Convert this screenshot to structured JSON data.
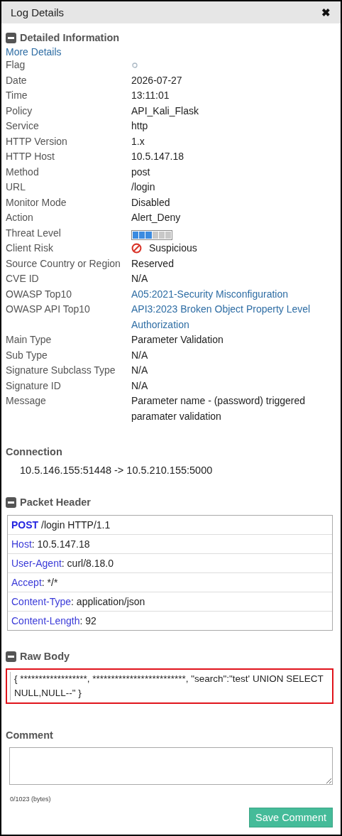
{
  "window": {
    "title": "Log Details",
    "close": "✖"
  },
  "details": {
    "title": "Detailed Information",
    "expanded": true,
    "more_link": "More Details",
    "fields": [
      {
        "label": "Flag",
        "kind": "flag",
        "flagged": false
      },
      {
        "label": "Date",
        "kind": "text",
        "value": "2026-07-27"
      },
      {
        "label": "Time",
        "kind": "text",
        "value": "13:11:01"
      },
      {
        "label": "Policy",
        "kind": "text",
        "value": "API_Kali_Flask"
      },
      {
        "label": "Service",
        "kind": "text",
        "value": "http"
      },
      {
        "label": "HTTP Version",
        "kind": "text",
        "value": "1.x"
      },
      {
        "label": "HTTP Host",
        "kind": "text",
        "value": "10.5.147.18"
      },
      {
        "label": "Method",
        "kind": "text",
        "value": "post"
      },
      {
        "label": "URL",
        "kind": "text",
        "value": "/login"
      },
      {
        "label": "Monitor Mode",
        "kind": "text",
        "value": "Disabled"
      },
      {
        "label": "Action",
        "kind": "text",
        "value": "Alert_Deny"
      },
      {
        "label": "Threat Level",
        "kind": "meter",
        "level": 0.5
      },
      {
        "label": "Client Risk",
        "kind": "risk",
        "value": "Suspicious"
      },
      {
        "label": "Source Country or Region",
        "kind": "text",
        "value": "Reserved"
      },
      {
        "label": "CVE ID",
        "kind": "text",
        "value": "N/A"
      },
      {
        "label": "OWASP Top10",
        "kind": "link",
        "value": "A05:2021-Security Misconfiguration"
      },
      {
        "label": "OWASP API Top10",
        "kind": "link",
        "value": "API3:2023 Broken Object Property Level Authorization"
      },
      {
        "label": "Main Type",
        "kind": "text",
        "value": "Parameter Validation"
      },
      {
        "label": "Sub Type",
        "kind": "text",
        "value": "N/A"
      },
      {
        "label": "Signature Subclass Type",
        "kind": "text",
        "value": "N/A"
      },
      {
        "label": "Signature ID",
        "kind": "text",
        "value": "N/A"
      },
      {
        "label": "Message",
        "kind": "text",
        "value": "Parameter name - (password) triggered paramater validation"
      }
    ]
  },
  "connection": {
    "title": "Connection",
    "value": "10.5.146.155:51448 -> 10.5.210.155:5000"
  },
  "packet_header": {
    "title": "Packet Header",
    "expanded": true,
    "lines": [
      {
        "kind": "request",
        "name": "POST",
        "rest": " /login HTTP/1.1"
      },
      {
        "kind": "header",
        "name": "Host",
        "rest": ": 10.5.147.18"
      },
      {
        "kind": "header",
        "name": "User-Agent",
        "rest": ": curl/8.18.0"
      },
      {
        "kind": "header",
        "name": "Accept",
        "rest": ": */*"
      },
      {
        "kind": "header",
        "name": "Content-Type",
        "rest": ": application/json"
      },
      {
        "kind": "header",
        "name": "Content-Length",
        "rest": ": 92"
      }
    ]
  },
  "raw_body": {
    "title": "Raw Body",
    "expanded": true,
    "text": "{ ******************, *************************, \"search\":\"test' UNION SELECT NULL,NULL--\" }"
  },
  "comment": {
    "title": "Comment",
    "counter": "0/1023 (bytes)",
    "save_button": "Save Comment"
  }
}
